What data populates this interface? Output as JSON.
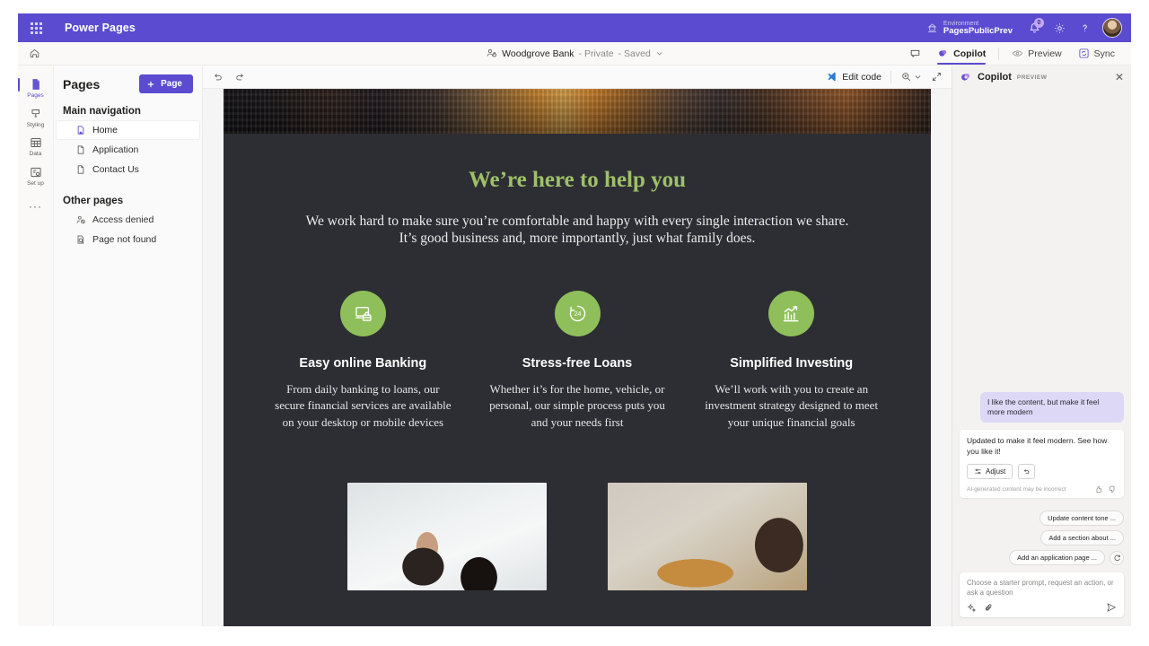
{
  "app_header": {
    "waffle_icon": "app-launcher-icon",
    "brand": "Power Pages",
    "environment_label": "Environment",
    "environment_name": "PagesPublicPrev",
    "notifications_count": "0",
    "icons": [
      "environment-icon",
      "notifications-bell-icon",
      "settings-gear-icon",
      "help-question-icon",
      "user-avatar"
    ]
  },
  "sub_header": {
    "home_icon": "home-icon",
    "site_name": "Woodgrove Bank",
    "site_visibility": "- Private",
    "site_status": "- Saved",
    "chevron": "chevron-down-icon",
    "tabs": [
      {
        "label": "",
        "icon": "comment-icon",
        "active": false
      },
      {
        "label": "Copilot",
        "icon": "copilot-icon",
        "active": true
      },
      {
        "label": "Preview",
        "icon": "eye-icon",
        "active": false
      },
      {
        "label": "Sync",
        "icon": "sync-icon",
        "active": false
      }
    ]
  },
  "rail": {
    "items": [
      {
        "label": "Pages",
        "icon": "page-icon",
        "active": true
      },
      {
        "label": "Styling",
        "icon": "paint-bucket-icon",
        "active": false
      },
      {
        "label": "Data",
        "icon": "table-icon",
        "active": false
      },
      {
        "label": "Set up",
        "icon": "setup-gear-icon",
        "active": false
      }
    ],
    "more": "···"
  },
  "pages_panel": {
    "title": "Pages",
    "new_page_button": "Page",
    "plus_icon": "plus-icon",
    "groups": [
      {
        "title": "Main navigation",
        "items": [
          {
            "label": "Home",
            "icon": "home-page-icon",
            "active": true
          },
          {
            "label": "Application",
            "icon": "page-file-icon",
            "active": false
          },
          {
            "label": "Contact Us",
            "icon": "page-file-icon",
            "active": false
          }
        ]
      },
      {
        "title": "Other pages",
        "items": [
          {
            "label": "Access denied",
            "icon": "access-denied-icon",
            "active": false
          },
          {
            "label": "Page not found",
            "icon": "page-not-found-icon",
            "active": false
          }
        ]
      }
    ]
  },
  "canvas_toolbar": {
    "undo_icon": "undo-icon",
    "redo_icon": "redo-icon",
    "edit_code": "Edit code",
    "edit_code_icon": "vscode-icon",
    "zoom_icon": "zoom-magnifier-icon",
    "zoom_chevron": "chevron-down-icon",
    "expand_icon": "expand-diagonal-icon"
  },
  "site_page": {
    "hero_image": "city-skyline-sunset-photo",
    "heading": "We’re here to help you",
    "subheading": "We work hard to make sure you’re comfortable and happy with every single interaction we share. It’s good business and, more importantly, just what family does.",
    "features": [
      {
        "icon": "online-banking-monitor-icon",
        "title": "Easy online Banking",
        "body": "From daily banking to loans, our secure financial services are available on your desktop or mobile devices"
      },
      {
        "icon": "24-hour-clock-icon",
        "title": "Stress-free Loans",
        "body": "Whether it’s for the home, vehicle, or personal, our simple process puts you and your needs first"
      },
      {
        "icon": "growth-chart-arrow-icon",
        "title": "Simplified Investing",
        "body": "We’ll work with you to create an investment strategy designed to meet your unique financial goals"
      }
    ],
    "photos": [
      "people-in-office-photo",
      "woman-outdoors-autumn-photo"
    ],
    "accent_color": "#8fbf5a",
    "heading_color": "#9ec06a",
    "background_color": "#2d2e33"
  },
  "copilot": {
    "title": "Copilot",
    "preview_tag": "PREVIEW",
    "close_icon": "close-icon",
    "messages": [
      {
        "role": "user",
        "text": "I like the content, but make it feel more modern"
      },
      {
        "role": "assistant",
        "text": "Updated to make it feel modern. See how you like it!"
      }
    ],
    "assistant_actions": {
      "adjust_label": "Adjust",
      "adjust_icon": "sliders-icon",
      "undo_icon": "undo-arrow-icon",
      "disclaimer": "AI-generated content may be incorrect",
      "thumbs_up_icon": "thumbs-up-icon",
      "thumbs_down_icon": "thumbs-down-icon"
    },
    "suggestions": [
      "Update content tone ...",
      "Add a section about ...",
      "Add an application page ..."
    ],
    "refresh_icon": "refresh-icon",
    "composer": {
      "placeholder": "Choose a starter prompt, request an action, or ask a question",
      "sparkle_icon": "sparkle-icon",
      "attach_icon": "paperclip-icon",
      "send_icon": "send-icon"
    }
  },
  "colors": {
    "brand_purple": "#5b4bd0",
    "canvas_dark": "#2d2e33",
    "green_accent": "#8fbf5a"
  }
}
